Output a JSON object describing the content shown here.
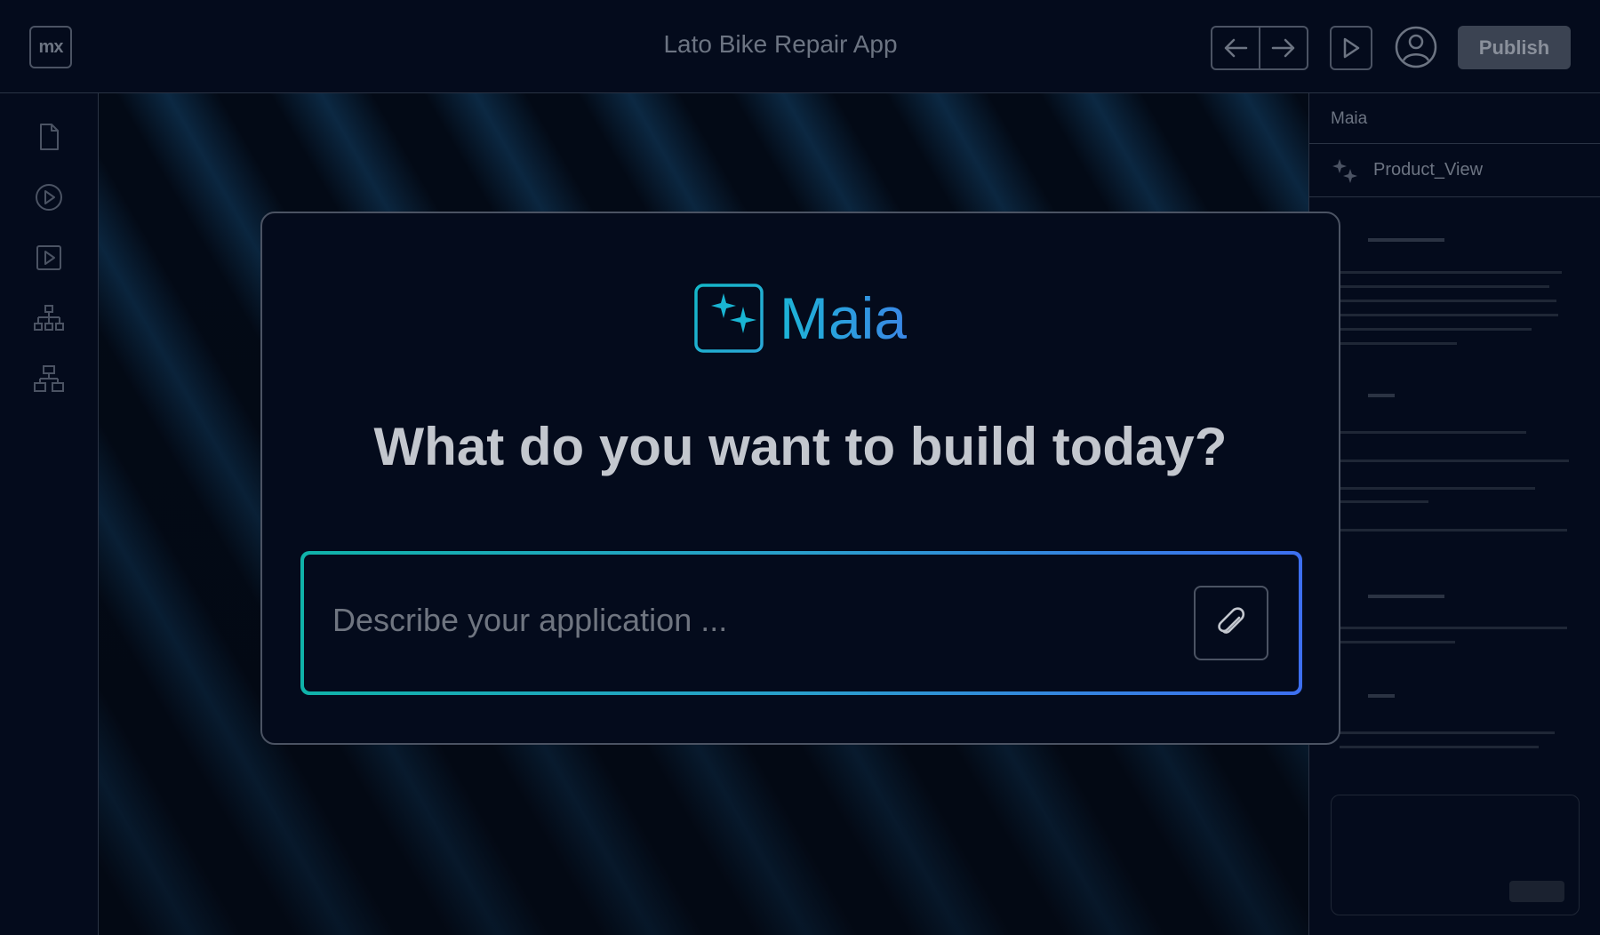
{
  "topbar": {
    "logo_text": "mx",
    "app_title": "Lato Bike Repair App",
    "back_icon": "arrow-left-icon",
    "forward_icon": "arrow-right-icon",
    "run_icon": "play-icon",
    "account_icon": "user-circle-icon",
    "publish_label": "Publish"
  },
  "sidebar": {
    "items": [
      {
        "icon": "document-icon"
      },
      {
        "icon": "play-circle-icon"
      },
      {
        "icon": "play-square-icon"
      },
      {
        "icon": "sitemap-icon"
      },
      {
        "icon": "hierarchy-icon"
      }
    ]
  },
  "right_panel": {
    "title": "Maia",
    "tab_label": "Product_View",
    "tab_icon": "sparkles-icon"
  },
  "modal": {
    "brand_name": "Maia",
    "brand_icon": "sparkles-icon",
    "headline": "What do you want to build today?",
    "prompt_placeholder": "Describe your application ...",
    "prompt_value": "",
    "attach_icon": "paperclip-icon"
  },
  "colors": {
    "background": "#040b1c",
    "border": "#4b5363",
    "accent_start": "#10b3a9",
    "accent_end": "#3d6ff0",
    "brand_text": "#1cb5d6"
  }
}
